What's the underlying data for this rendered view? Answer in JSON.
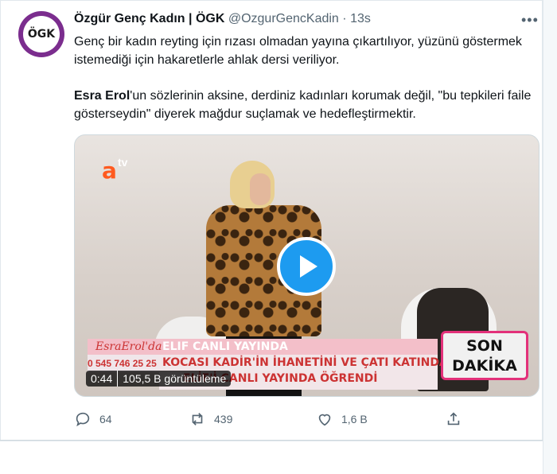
{
  "tweet": {
    "name": "Özgür Genç Kadın | ÖGK",
    "handle": "@OzgurGencKadin",
    "separator": "·",
    "time": "13s",
    "avatar_text": "ÖGK",
    "text1": "Genç bir kadın reyting için rızası olmadan yayına çıkartılıyor, yüzünü göstermek istemediği için hakaretlerle ahlak dersi veriliyor.",
    "text2_bold": "Esra Erol",
    "text2_rest": "'un sözlerinin aksine, derdiniz kadınları korumak değil, \"bu tepkileri faile gösterseydin\" diyerek mağdur suçlamak ve hedefleştirmektir."
  },
  "video": {
    "logo_a": "a",
    "logo_tv": "tv",
    "overlay_show": "EsraErol'da",
    "overlay_live": "ELIF CANLI YAYINDA",
    "overlay_phone": "0 545 746 25 25",
    "overlay_line1": "KOCASI KADİR'İN İHANETİNİ VE ÇATI KATINDA",
    "overlay_line2": "ELİF'İ CANLI YAYINDA ÖĞRENDİ",
    "son_dakika_1": "SON",
    "son_dakika_2": "DAKİKA",
    "duration": "0:44",
    "views": "105,5 B görüntüleme"
  },
  "actions": {
    "replies": "64",
    "retweets": "439",
    "likes": "1,6 B"
  },
  "icons": [
    "more-icon",
    "reply-icon",
    "retweet-icon",
    "like-icon",
    "share-icon",
    "play-icon"
  ],
  "colors": {
    "accent": "#1d9bf0",
    "text": "#0f1419",
    "muted": "#536471"
  }
}
